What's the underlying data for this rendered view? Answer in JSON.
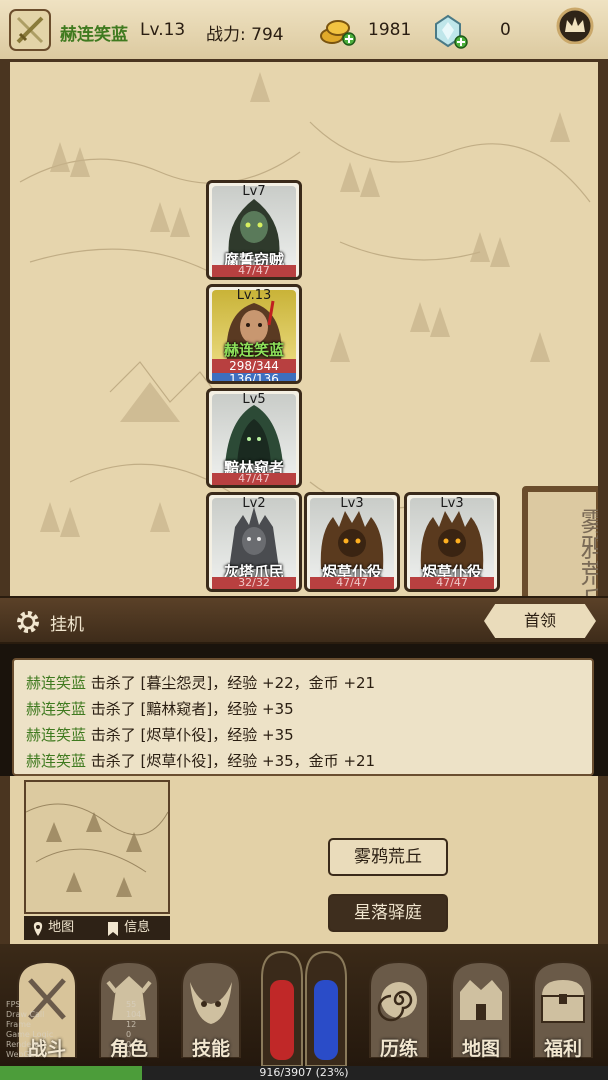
{
  "player": {
    "name": "赫连笑蓝",
    "level": "Lv.13",
    "power": "战力: 794",
    "gold": "1981",
    "gems": "0"
  },
  "vip_label": "特权",
  "zone_name": "雾鸦荒丘",
  "cards": [
    {
      "lv": "Lv7",
      "name": "腐誓窃贼",
      "hp": "47/47"
    },
    {
      "lv": "Lv.13",
      "name": "赫连笑蓝",
      "hp": "298/344",
      "mp": "136/136"
    },
    {
      "lv": "Lv5",
      "name": "黯林窥者",
      "hp": "47/47"
    },
    {
      "lv": "Lv2",
      "name": "灰塔爪民",
      "hp": "32/32"
    },
    {
      "lv": "Lv3",
      "name": "烬草仆役",
      "hp": "47/47"
    },
    {
      "lv": "Lv3",
      "name": "烬草仆役",
      "hp": "47/47"
    }
  ],
  "idle": {
    "label": "挂机",
    "boss_button": "首领"
  },
  "log": [
    {
      "who": "赫连笑蓝",
      "text": " 击杀了 [暮尘怨灵]，经验 +22，金币 +21"
    },
    {
      "who": "赫连笑蓝",
      "text": " 击杀了 [黯林窥者]，经验 +35"
    },
    {
      "who": "赫连笑蓝",
      "text": " 击杀了 [烬草仆役]，经验 +35"
    },
    {
      "who": "赫连笑蓝",
      "text": " 击杀了 [烬草仆役]，经验 +35，金币 +21"
    }
  ],
  "minimap_tabs": {
    "map": "地图",
    "info": "信息"
  },
  "locations": {
    "current": "雾鸦荒丘",
    "next": "星落驿庭"
  },
  "nav": [
    {
      "label": "战斗",
      "icon": "crossed-swords-icon"
    },
    {
      "label": "角色",
      "icon": "helmet-icon"
    },
    {
      "label": "技能",
      "icon": "skill-mask-icon"
    },
    {
      "label": "历练",
      "icon": "spiral-icon"
    },
    {
      "label": "地图",
      "icon": "map-castle-icon"
    },
    {
      "label": "福利",
      "icon": "chest-icon"
    }
  ],
  "debug_left": [
    "FPS",
    "Draw Call",
    "Frame",
    "Game Logic",
    "Renderer",
    "WebGL"
  ],
  "debug_right": [
    "55",
    "104",
    "12",
    "0",
    "0",
    "0"
  ],
  "xp": {
    "text": "916/3907 (23%)",
    "fraction": 0.234
  },
  "colors": {
    "hero_name": "#3f7a1f",
    "hp": "#b84040",
    "mp": "#3d6fbf",
    "xp_fill": "#4c9d3a"
  }
}
